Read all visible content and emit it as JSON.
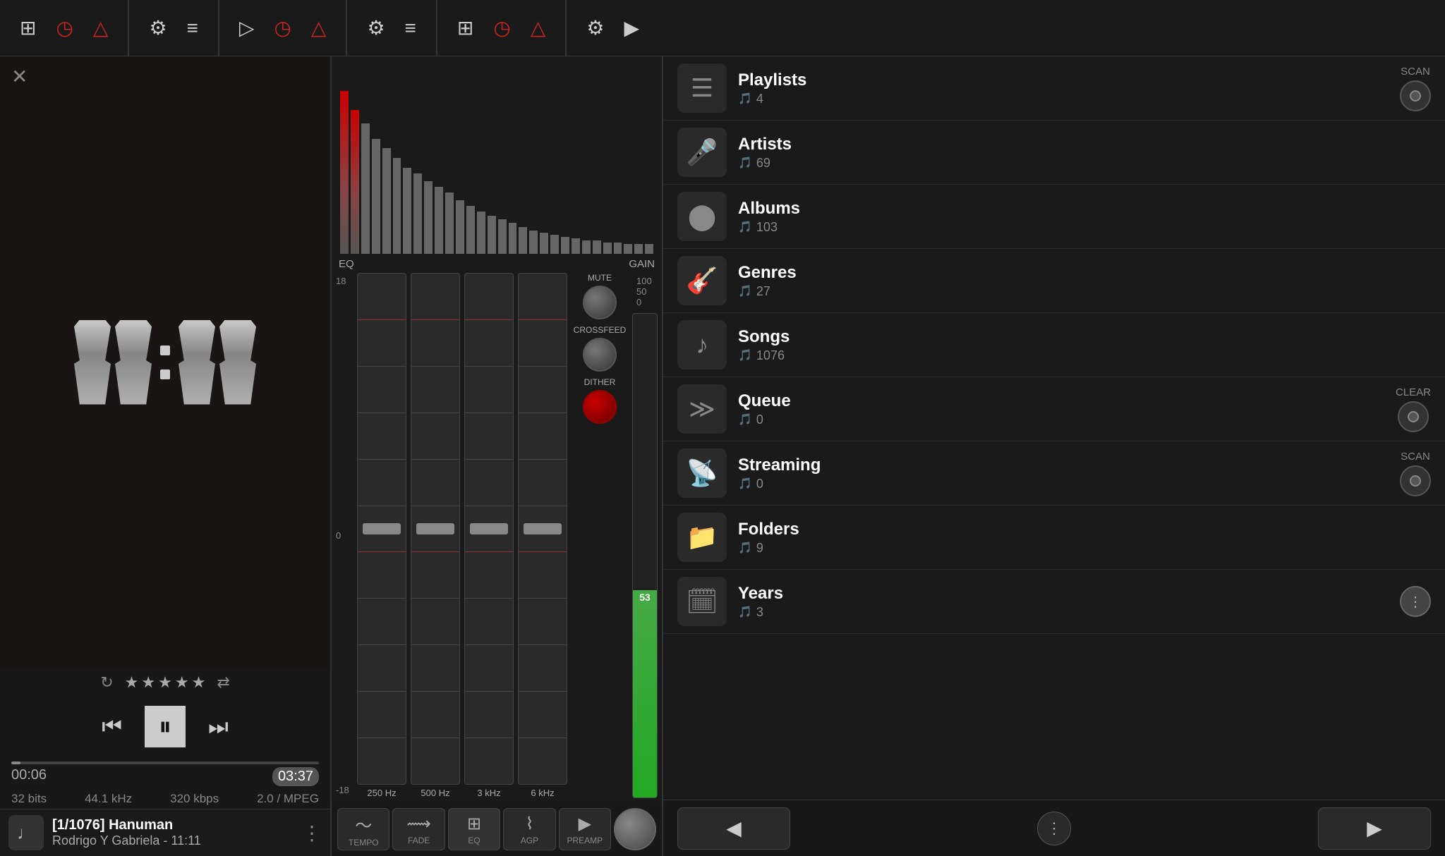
{
  "topNav": {
    "leftIcons": [
      "equalizer",
      "clock",
      "alarm"
    ],
    "midIcons": [
      "play",
      "clock",
      "alarm",
      "settings",
      "menu",
      "equalizer",
      "clock",
      "alarm"
    ],
    "rightIcons": [
      "settings",
      "play"
    ]
  },
  "player": {
    "closeLabel": "✕",
    "time": "11:11",
    "repeatIcon": "↻",
    "shuffleIcon": "⇄",
    "stars": [
      "★",
      "★",
      "★",
      "★",
      "★"
    ],
    "prevLabel": "⏮",
    "playLabel": "⏸",
    "nextLabel": "⏭",
    "timeStart": "00:06",
    "timeEnd": "03:37",
    "bitDepth": "32 bits",
    "sampleRate": "44.1 kHz",
    "bitrate": "320 kbps",
    "format": "2.0 / MPEG",
    "trackNumber": "[1/1076]",
    "trackTitle": "Hanuman",
    "trackArtist": "Rodrigo Y Gabriela - 11:11",
    "moreLabel": "⋮"
  },
  "eq": {
    "title": "EQ",
    "gainLabel": "GAIN",
    "gainValue": "53",
    "muteLabel": "MUTE",
    "crossfeedLabel": "CROSSFEED",
    "ditherLabel": "DITHER",
    "bands": [
      {
        "label": "250 Hz"
      },
      {
        "label": "500 Hz"
      },
      {
        "label": "3 kHz"
      },
      {
        "label": "6 kHz"
      }
    ],
    "scaleTop": "18",
    "scaleZero": "0",
    "scaleBottom": "-18",
    "gainTop": "100",
    "gainZero": "50",
    "gainBottom": "0"
  },
  "bottomButtons": [
    {
      "label": "TEMPO",
      "icon": "〜"
    },
    {
      "label": "FADE",
      "icon": "⟿"
    },
    {
      "label": "EQ",
      "icon": "⊞"
    },
    {
      "label": "AGP",
      "icon": "⌇"
    },
    {
      "label": "PREAMP",
      "icon": "▶"
    }
  ],
  "library": {
    "items": [
      {
        "id": "playlists",
        "title": "Playlists",
        "count": "4",
        "icon": "☰",
        "hasScan": true,
        "scanLabel": "SCAN",
        "hasAction": false
      },
      {
        "id": "artists",
        "title": "Artists",
        "count": "69",
        "icon": "🎤",
        "hasScan": false
      },
      {
        "id": "albums",
        "title": "Albums",
        "count": "103",
        "icon": "⬤",
        "hasScan": false
      },
      {
        "id": "genres",
        "title": "Genres",
        "count": "27",
        "icon": "🎸",
        "hasScan": false
      },
      {
        "id": "songs",
        "title": "Songs",
        "count": "1076",
        "icon": "♪",
        "hasScan": false
      },
      {
        "id": "queue",
        "title": "Queue",
        "count": "0",
        "icon": "≫",
        "hasScan": false,
        "hasClear": true,
        "clearLabel": "CLEAR"
      },
      {
        "id": "streaming",
        "title": "Streaming",
        "count": "0",
        "icon": "📡",
        "hasScan": true,
        "scanLabel": "SCAN"
      },
      {
        "id": "folders",
        "title": "Folders",
        "count": "9",
        "icon": "📁",
        "hasScan": false
      },
      {
        "id": "years",
        "title": "Years",
        "count": "3",
        "icon": "🗓",
        "hasScan": false,
        "hasMore": true
      }
    ],
    "bottomNav": {
      "prevLabel": "◀",
      "nextLabel": "▶",
      "moreLabel": "⋮"
    }
  }
}
